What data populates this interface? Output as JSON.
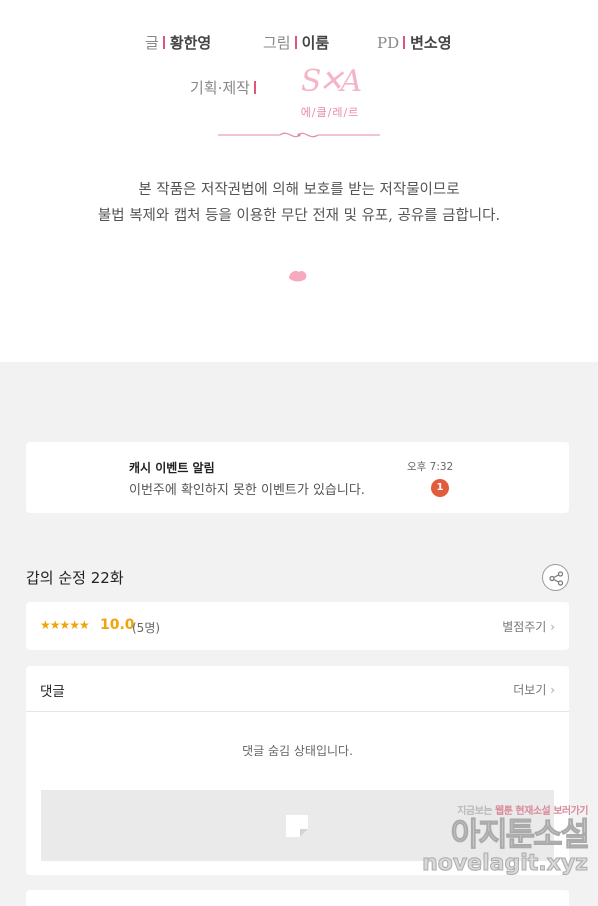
{
  "credits": {
    "writer_role": "글",
    "writer_name": "황한영",
    "artist_role": "그림",
    "artist_name": "이룸",
    "pd_role": "PD",
    "pd_name": "변소영",
    "production_role": "기획·제작",
    "studio_logo_mark": "S✕A",
    "studio_name": "에/클/레/르"
  },
  "copyright": {
    "line1": "본 작품은 저작권법에 의해 보호를 받는 저작물이므로",
    "line2": "불법 복제와 캡처 등을 이용한 무단 전재 및 유포, 공유를 금합니다."
  },
  "notification": {
    "title": "캐시 이벤트 알림",
    "body": "이번주에 확인하지 못한 이벤트가 있습니다.",
    "time": "오후 7:32",
    "badge_count": "1",
    "badge_color": "#e35b3d"
  },
  "episode": {
    "title": "갑의 순정 22화",
    "share_icon": "share-icon"
  },
  "rating": {
    "stars": "★★★★★",
    "score": "10.0",
    "count": "(5명)",
    "rate_button": "별점주기",
    "accent_color": "#f0a30a"
  },
  "comments": {
    "header": "댓글",
    "more_label": "더보기",
    "hidden_message": "댓글 숨김 상태입니다."
  },
  "watermark": {
    "top_text_a": "지금보는 ",
    "top_text_hi": "웹툰 현재소설 보러가기",
    "main": "아지툰소설",
    "url": "novelagit.xyz"
  }
}
